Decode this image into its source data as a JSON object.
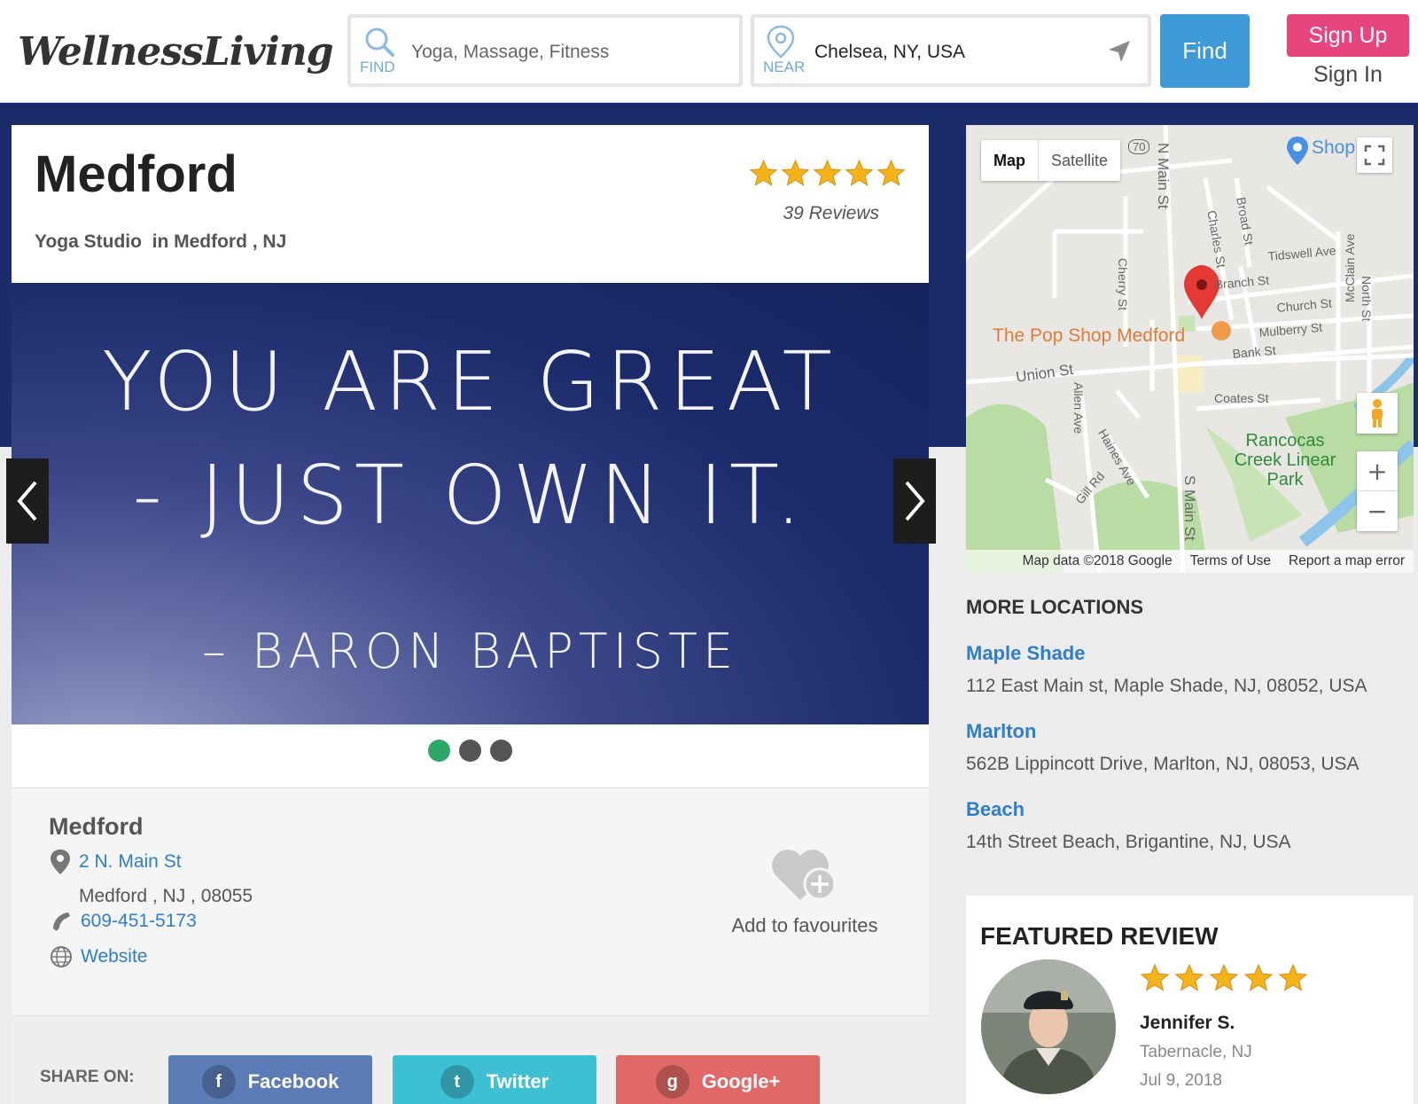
{
  "brand": {
    "name": "WellnessLiving"
  },
  "search": {
    "find_placeholder": "Yoga, Massage, Fitness",
    "find_tag": "FIND",
    "near_value": "Chelsea, NY, USA",
    "near_tag": "NEAR",
    "find_button": "Find"
  },
  "auth": {
    "signup": "Sign Up",
    "signin": "Sign In"
  },
  "business": {
    "name": "Medford",
    "category": "Yoga Studio",
    "location_text": "in Medford , NJ",
    "rating": 5,
    "reviews": "39 Reviews"
  },
  "slideshow": {
    "line1": "YOU ARE GREAT",
    "line2": "- JUST OWN IT.",
    "line3": "– BARON BAPTISTE",
    "slide_count": 3,
    "active_slide": 1
  },
  "info": {
    "name": "Medford",
    "street": "2 N. Main St",
    "city_line": "Medford , NJ , 08055",
    "phone": "609-451-5173",
    "website": "Website",
    "favourite": "Add to favourites"
  },
  "share": {
    "label": "SHARE ON:",
    "facebook": "Facebook",
    "twitter": "Twitter",
    "googleplus": "Google+"
  },
  "map": {
    "tab_map": "Map",
    "tab_satellite": "Satellite",
    "place_label": "The Pop Shop Medford",
    "shop_label": "Shop",
    "park_label": "Rancocas Creek Linear Park",
    "streets": [
      "N Main St",
      "Charles St",
      "Broad St",
      "Tidswell Ave",
      "Branch St",
      "Church St",
      "Mulberry St",
      "Bank St",
      "Cherry St",
      "Union St",
      "Coates St",
      "Allen Ave",
      "Haines Ave",
      "Gill Rd",
      "S Main St",
      "McClain Ave",
      "North St"
    ],
    "route_number": "70",
    "attribution": "Map data ©2018 Google",
    "terms": "Terms of Use",
    "report": "Report a map error"
  },
  "more_locations": {
    "title": "MORE LOCATIONS",
    "items": [
      {
        "name": "Maple Shade",
        "address": "112 East Main st, Maple Shade, NJ, 08052, USA"
      },
      {
        "name": "Marlton",
        "address": "562B Lippincott Drive, Marlton, NJ, 08053, USA"
      },
      {
        "name": "Beach",
        "address": "14th Street Beach, Brigantine, NJ, USA"
      }
    ]
  },
  "featured_review": {
    "title": "FEATURED REVIEW",
    "rating": 5,
    "name": "Jennifer S.",
    "location": "Tabernacle, NJ",
    "date": "Jul 9, 2018"
  },
  "colors": {
    "accent_blue": "#3d9ad6",
    "signup_pink": "#e8457e",
    "link_blue": "#2e7ec8",
    "star_gold": "#f5b31b",
    "hero_navy": "#1b2c6a",
    "dot_active": "#2ea86a"
  }
}
